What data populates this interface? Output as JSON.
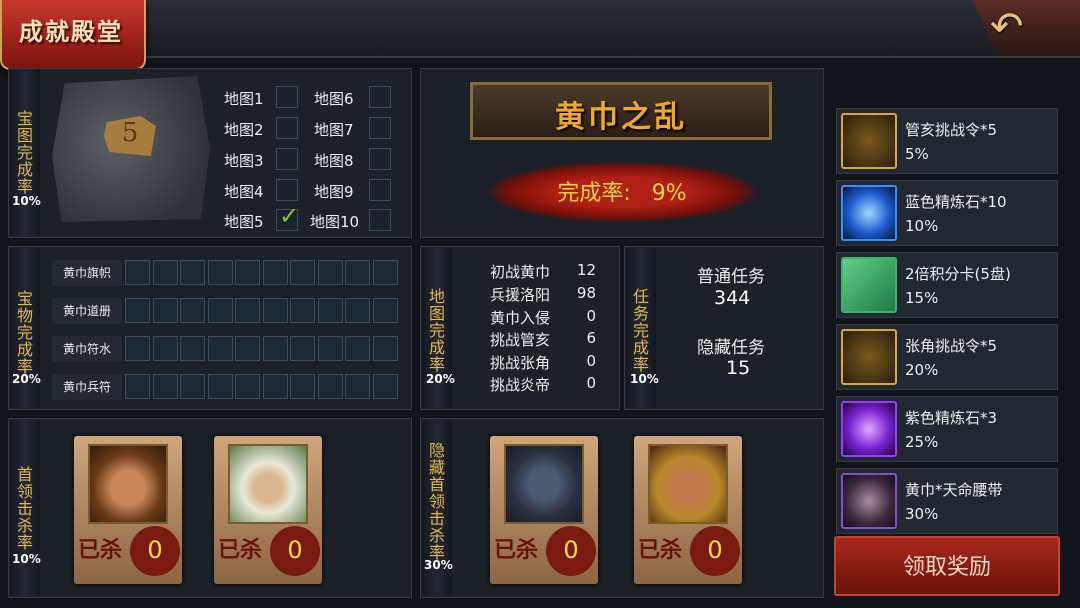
{
  "header": {
    "title": "成就殿堂",
    "back_icon": "↶"
  },
  "treasure_map": {
    "label": "宝图完成率",
    "percent": "10%",
    "piece_number": "5",
    "maps": [
      {
        "label": "地图1",
        "checked": false
      },
      {
        "label": "地图2",
        "checked": false
      },
      {
        "label": "地图3",
        "checked": false
      },
      {
        "label": "地图4",
        "checked": false
      },
      {
        "label": "地图5",
        "checked": true
      },
      {
        "label": "地图6",
        "checked": false
      },
      {
        "label": "地图7",
        "checked": false
      },
      {
        "label": "地图8",
        "checked": false
      },
      {
        "label": "地图9",
        "checked": false
      },
      {
        "label": "地图10",
        "checked": false
      }
    ]
  },
  "chapter": {
    "title": "黄巾之乱",
    "completion_label": "完成率:",
    "completion_value": "9%"
  },
  "treasures": {
    "label": "宝物完成率",
    "percent": "20%",
    "rows": [
      "黄巾旗帜",
      "黄巾道册",
      "黄巾符水",
      "黄巾兵符"
    ]
  },
  "map_completion": {
    "label": "地图完成率",
    "percent": "20%",
    "items": [
      {
        "name": "初战黄巾",
        "value": "12"
      },
      {
        "name": "兵援洛阳",
        "value": "98"
      },
      {
        "name": "黄巾入侵",
        "value": "0"
      },
      {
        "name": "挑战管亥",
        "value": "6"
      },
      {
        "name": "挑战张角",
        "value": "0"
      },
      {
        "name": "挑战炎帝",
        "value": "0"
      }
    ]
  },
  "tasks": {
    "label": "任务完成率",
    "percent": "10%",
    "normal_label": "普通任务",
    "normal_value": "344",
    "hidden_label": "隐藏任务",
    "hidden_value": "15"
  },
  "boss_kill": {
    "label": "首领击杀率",
    "percent": "10%",
    "cards": [
      {
        "mark": "已杀",
        "count": "0"
      },
      {
        "mark": "已杀",
        "count": "0"
      }
    ]
  },
  "hidden_boss_kill": {
    "label": "隐藏首领击杀率",
    "percent": "30%",
    "cards": [
      {
        "mark": "已杀",
        "count": "0"
      },
      {
        "mark": "已杀",
        "count": "0"
      }
    ]
  },
  "rewards": [
    {
      "name": "管亥挑战令*5",
      "percent": "5%",
      "icon": "token-icon",
      "color": "#d8a93c"
    },
    {
      "name": "蓝色精炼石*10",
      "percent": "10%",
      "icon": "blue-gem-icon",
      "color": "#3b8cff"
    },
    {
      "name": "2倍积分卡(5盘)",
      "percent": "15%",
      "icon": "card-icon",
      "color": "#3fb36a"
    },
    {
      "name": "张角挑战令*5",
      "percent": "20%",
      "icon": "token-icon",
      "color": "#d8a93c"
    },
    {
      "name": "紫色精炼石*3",
      "percent": "25%",
      "icon": "purple-gem-icon",
      "color": "#9b3bff"
    },
    {
      "name": "黄巾*天命腰带",
      "percent": "30%",
      "icon": "belt-icon",
      "color": "#8a4fbf"
    }
  ],
  "claim_button": "领取奖励"
}
